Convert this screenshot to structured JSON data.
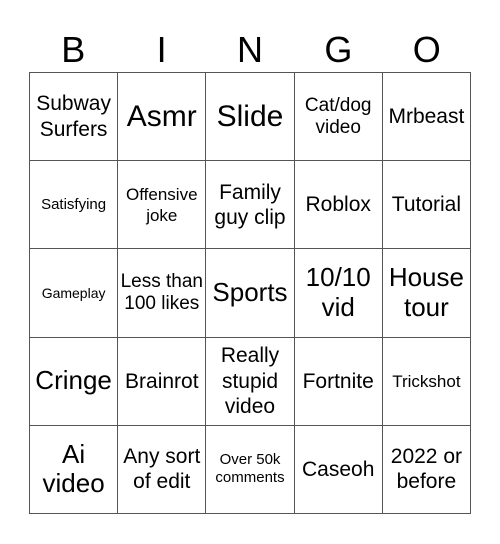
{
  "header": {
    "letters": [
      "B",
      "I",
      "N",
      "G",
      "O"
    ]
  },
  "cells": [
    [
      "Subway Surfers",
      "Asmr",
      "Slide",
      "Cat/dog video",
      "Mrbeast"
    ],
    [
      "Satisfying",
      "Offensive joke",
      "Family guy clip",
      "Roblox",
      "Tutorial"
    ],
    [
      "Gameplay",
      "Less than 100 likes",
      "Sports",
      "10/10 vid",
      "House tour"
    ],
    [
      "Cringe",
      "Brainrot",
      "Really stupid video",
      "Fortnite",
      "Trickshot"
    ],
    [
      "Ai video",
      "Any sort of edit",
      "Over 50k comments",
      "Caseoh",
      "2022 or before"
    ]
  ]
}
